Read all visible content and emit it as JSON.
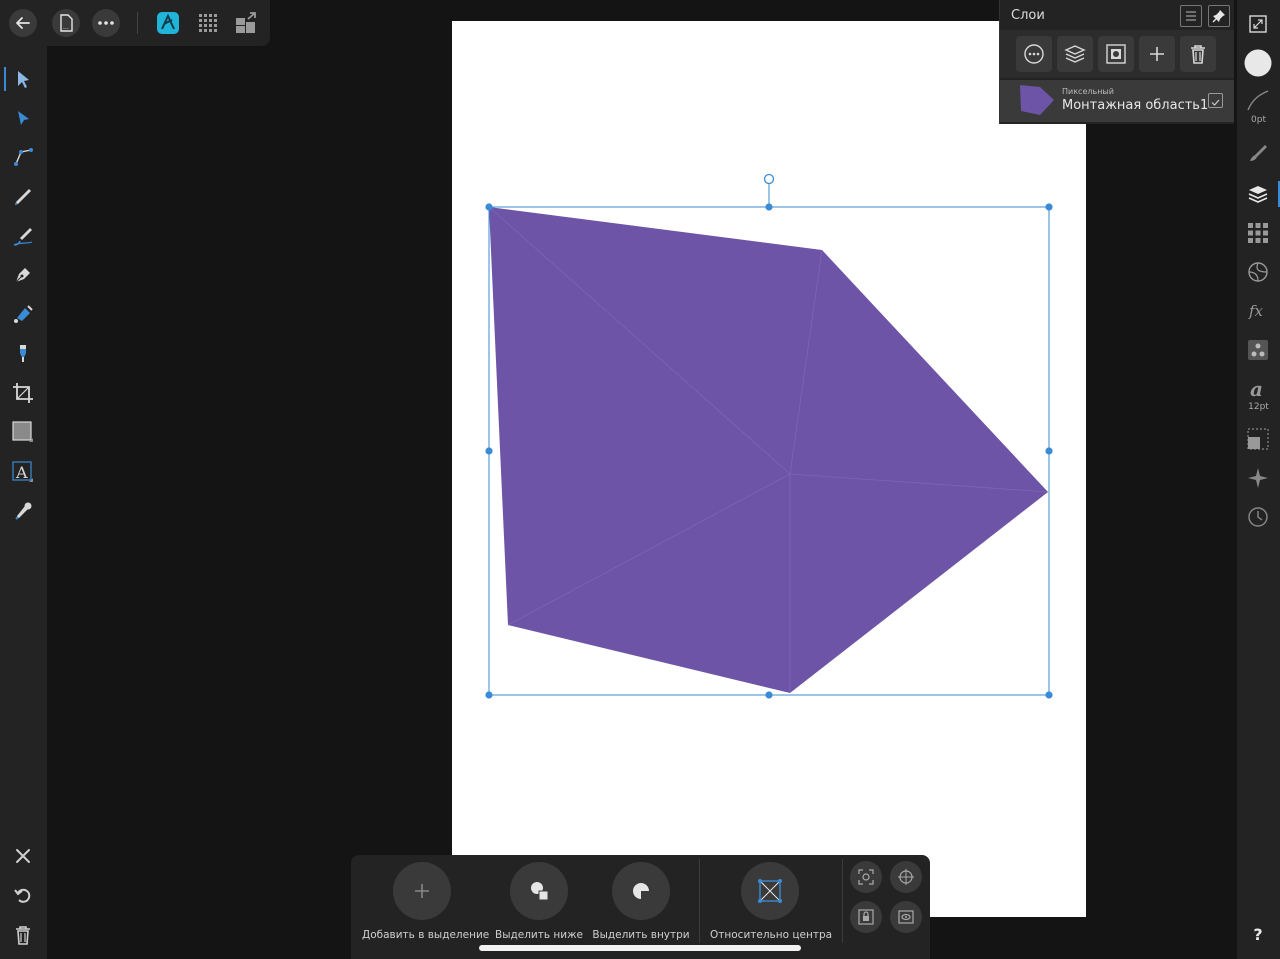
{
  "app": {
    "accent_color": "#3a8bd6",
    "shape_color": "#6e54a6",
    "persona_accent": "#20b4d8"
  },
  "topbar": {
    "back_icon": "back-arrow-icon",
    "document_icon": "document-icon",
    "more_icon": "more-dots-icon",
    "persona_designer_icon": "designer-persona-icon",
    "persona_pixel_icon": "pixel-persona-icon",
    "persona_export_icon": "export-persona-icon"
  },
  "left_tools": [
    {
      "name": "move-tool",
      "icon": "pointer-icon"
    },
    {
      "name": "node-tool",
      "icon": "node-pointer-icon"
    },
    {
      "name": "corner-tool",
      "icon": "corner-icon"
    },
    {
      "name": "pencil-tool",
      "icon": "pencil-icon"
    },
    {
      "name": "vector-brush-tool",
      "icon": "vector-brush-icon"
    },
    {
      "name": "pen-tool",
      "icon": "pen-nib-icon"
    },
    {
      "name": "fill-tool",
      "icon": "fill-icon"
    },
    {
      "name": "transparency-tool",
      "icon": "transparency-icon"
    },
    {
      "name": "crop-tool",
      "icon": "crop-icon"
    },
    {
      "name": "shape-tool",
      "icon": "square-icon"
    },
    {
      "name": "text-tool",
      "icon": "text-icon"
    },
    {
      "name": "color-picker-tool",
      "icon": "eyedropper-icon"
    }
  ],
  "left_bottom": {
    "close_icon": "close-icon",
    "undo_icon": "undo-icon",
    "delete_icon": "trash-icon"
  },
  "layers_panel": {
    "title": "Слои",
    "layer": {
      "type": "Пиксельный",
      "name": "Монтажная область1",
      "checked": true
    }
  },
  "right_panel": {
    "stroke_label": "0pt",
    "text_size_label": "12pt",
    "help_label": "?"
  },
  "context_toolbar": {
    "add_to_selection": "Добавить в выделение",
    "select_below": "Выделить ниже",
    "select_inside": "Выделить внутри",
    "relative_center": "Относительно центра"
  }
}
